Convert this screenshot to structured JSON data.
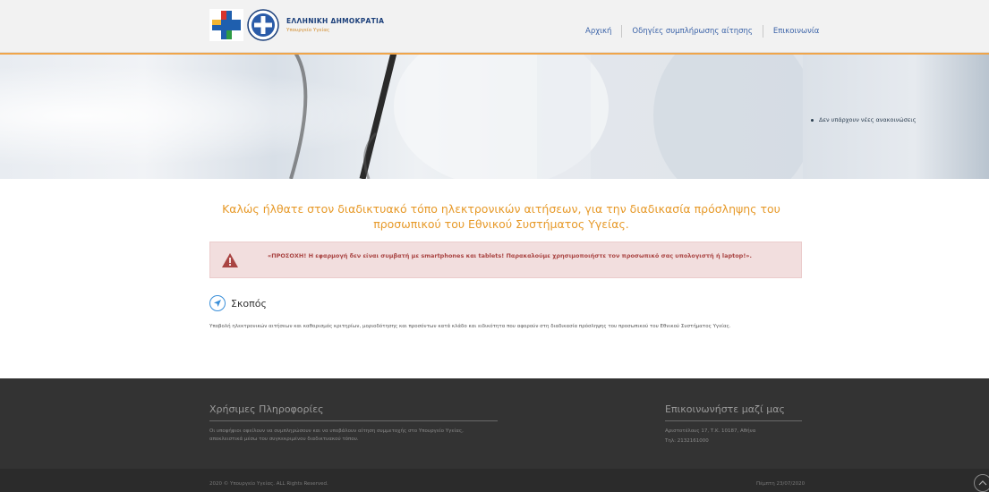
{
  "header": {
    "brand_title": "ΕΛΛΗΝΙΚΗ ΔΗΜΟΚΡΑΤΙΑ",
    "brand_subtitle": "Υπουργείο Υγείας",
    "nav": [
      {
        "label": "Αρχική"
      },
      {
        "label": "Οδηγίες συμπλήρωσης αίτησης"
      },
      {
        "label": "Επικοινωνία"
      }
    ]
  },
  "hero": {
    "announcement": "Δεν υπάρχουν νέες ανακοινώσεις"
  },
  "main": {
    "welcome": "Καλώς ήλθατε στον διαδικτυακό τόπο ηλεκτρονικών αιτήσεων, για την διαδικασία πρόσληψης του προσωπικού του Εθνικού Συστήματος Υγείας.",
    "alert": "«ΠΡΟΣΟΧΗ! Η εφαρμογή δεν είναι συμβατή με smartphones και tablets! Παρακαλούμε χρησιμοποιήστε τον προσωπικό σας υπολογιστή ή laptop!».",
    "purpose_title": "Σκοπός",
    "purpose_text": "Υποβολή ηλεκτρονικών αιτήσεων και καθορισμός κριτηρίων, μοριοδότησης και προσόντων κατά κλάδο και ειδικότητα που αφορούν στη διαδικασία πρόσληψης του προσωπικού του Εθνικού Συστήματος Υγείας."
  },
  "footer": {
    "info_title": "Χρήσιμες Πληροφορίες",
    "info_text": "Οι υποψήφιοι οφείλουν να συμπληρώσουν και να υποβάλουν αίτηση συμμετοχής στο Υπουργείο Υγείας, αποκλειστικά μέσω του συγκεκριμένου διαδικτυακού τόπου.",
    "contact_title": "Επικοινωνήστε μαζί μας",
    "contact_address": "Αριστοτέλους 17, Τ.Κ. 10187, Αθήνα",
    "contact_phone": "Τηλ: 2132161000",
    "copyright": "2020 © Υπουργείο Υγείας. ALL Rights Reserved.",
    "date": "Πέμπτη 23/07/2020"
  },
  "colors": {
    "accent": "#e79a2a",
    "nav_link": "#3b63a8",
    "alert_bg": "#f2dede",
    "alert_text": "#a94442",
    "footer_bg": "#333333"
  },
  "icons": [
    "health-cross-logo-icon",
    "greek-seal-icon",
    "warning-triangle-icon",
    "navigation-arrow-icon",
    "chevron-up-icon"
  ]
}
